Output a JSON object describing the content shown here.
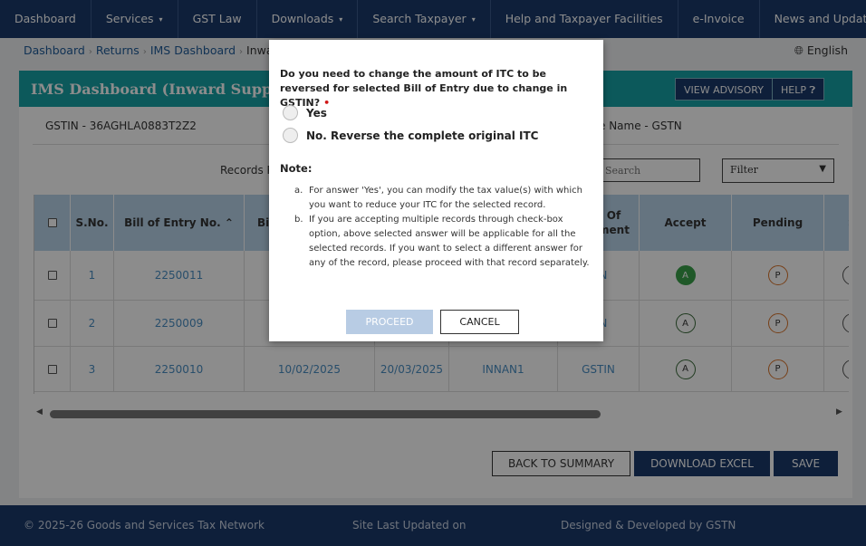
{
  "nav": {
    "items": [
      {
        "label": "Dashboard",
        "caret": false
      },
      {
        "label": "Services",
        "caret": true
      },
      {
        "label": "GST Law",
        "caret": false
      },
      {
        "label": "Downloads",
        "caret": true
      },
      {
        "label": "Search Taxpayer",
        "caret": true
      },
      {
        "label": "Help and Taxpayer Facilities",
        "caret": false
      },
      {
        "label": "e-Invoice",
        "caret": false
      },
      {
        "label": "News and Updates",
        "caret": false
      }
    ],
    "caret_glyph": "▾"
  },
  "breadcrumb": {
    "items": [
      "Dashboard",
      "Returns",
      "IMS Dashboard"
    ],
    "current": "Inwar",
    "separator": "›"
  },
  "language": {
    "icon": "globe-icon",
    "label": "English"
  },
  "panel": {
    "title": "IMS Dashboard (Inward Supplies",
    "advisory_label": "VIEW ADVISORY",
    "help_label": "HELP"
  },
  "taxpayer": {
    "gstin": "GSTIN - 36AGHLA0883T2Z2",
    "trade_name": "e Name - GSTN"
  },
  "records_label": "Records P",
  "search": {
    "placeholder": "Search"
  },
  "filter": {
    "label": "Filter"
  },
  "table": {
    "headers": {
      "sno": "S.No.",
      "boe": "Bill of Entry No. ⌃",
      "bi": "Bi",
      "doc": "Of\nment",
      "accept": "Accept",
      "pending": "Pending",
      "s": "S"
    },
    "rows": [
      {
        "sno": "1",
        "boe": "2250011",
        "date1": "",
        "date2": "",
        "col5": "",
        "col6": "TIN",
        "accept": "A",
        "accepted": true,
        "pending": "P"
      },
      {
        "sno": "2",
        "boe": "2250009",
        "date1": "",
        "date2": "",
        "col5": "",
        "col6": "TIN",
        "accept": "A",
        "accepted": false,
        "pending": "P"
      },
      {
        "sno": "3",
        "boe": "2250010",
        "date1": "10/02/2025",
        "date2": "20/03/2025",
        "col5": "INNAN1",
        "col6": "GSTIN",
        "accept": "A",
        "accepted": false,
        "pending": "P"
      }
    ]
  },
  "actions": {
    "back": "BACK TO SUMMARY",
    "download": "DOWNLOAD EXCEL",
    "save": "SAVE"
  },
  "footer": {
    "copyright": "© 2025-26 Goods and Services Tax Network",
    "updated": "Site Last Updated on",
    "designed": "Designed & Developed by GSTN"
  },
  "modal": {
    "question": "Do you need to change the amount of ITC to be reversed for selected Bill of Entry due to change in GSTIN?",
    "required_mark": "•",
    "options": [
      {
        "label": "Yes"
      },
      {
        "label": "No. Reverse the complete original ITC"
      }
    ],
    "note_title": "Note:",
    "notes": [
      {
        "marker": "a.",
        "text": "For answer 'Yes', you can modify the tax value(s) with which you want to reduce your ITC for the selected record."
      },
      {
        "marker": "b.",
        "text": "If you are accepting multiple records through check-box option, above selected answer will be applicable for all the selected records. If you want to select a different answer for any of the record, please proceed with that record separately."
      }
    ],
    "proceed": "PROCEED",
    "cancel": "CANCEL"
  },
  "colors": {
    "nav_bg": "#1b3a6b",
    "panel_header": "#17a3a6",
    "table_header": "#b8d3ea",
    "accept_selected": "#3aa04a",
    "pending_border": "#d9742b",
    "proceed_disabled": "#b8cce4",
    "required": "#d01515"
  }
}
